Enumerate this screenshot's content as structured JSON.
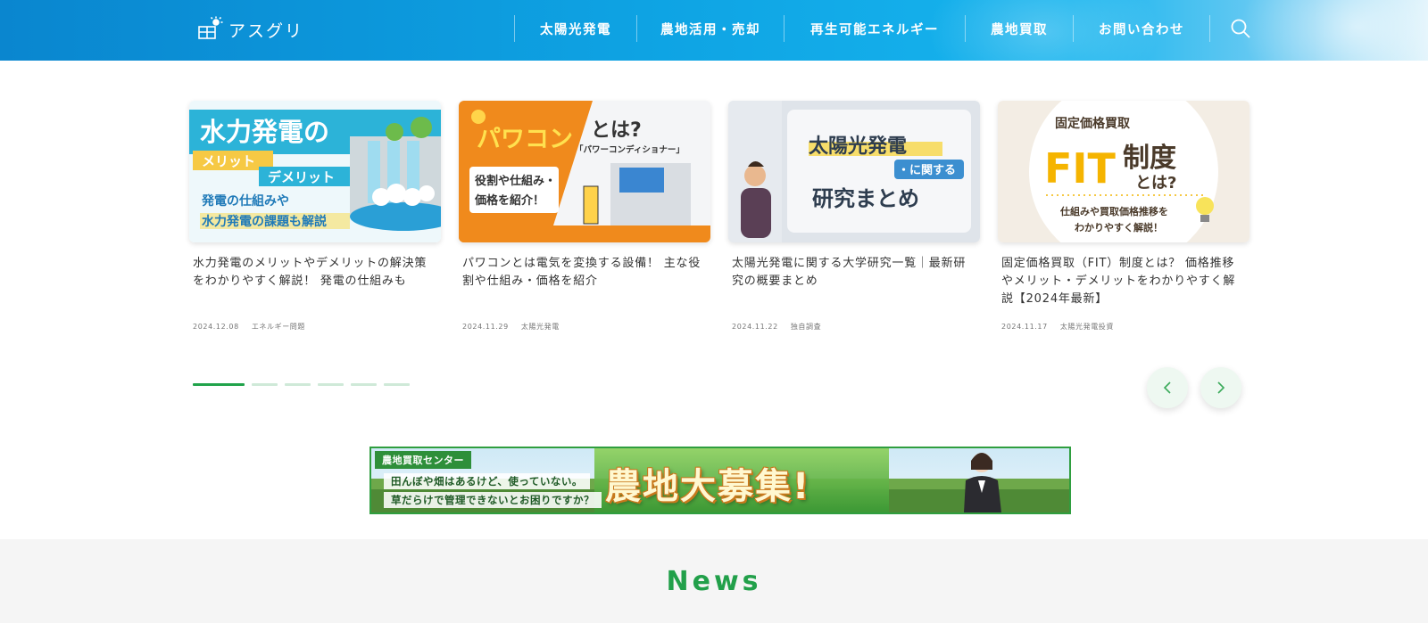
{
  "header": {
    "logo_text": "アスグリ",
    "nav": [
      {
        "label": "太陽光発電"
      },
      {
        "label": "農地活用・売却"
      },
      {
        "label": "再生可能エネルギー"
      },
      {
        "label": "農地買取"
      },
      {
        "label": "お問い合わせ"
      }
    ],
    "search_icon": "search-icon"
  },
  "carousel": {
    "cards": [
      {
        "title": "水力発電のメリットやデメリットの解決策をわかりやすく解説！ 発電の仕組みも",
        "date": "2024.12.08",
        "category": "エネルギー問題",
        "thumb": {
          "line1": "水力発電の",
          "badge1": "メリット",
          "badge2": "デメリット",
          "sub1": "発電の仕組みや",
          "sub2": "水力発電の課題も解説"
        }
      },
      {
        "title": "パワコンとは電気を変換する設備！ 主な役割や仕組み・価格を紹介",
        "date": "2024.11.29",
        "category": "太陽光発電",
        "thumb": {
          "line1": "パワコン",
          "line1b": "とは?",
          "sub0": "「パワーコンディショナー」",
          "sub1": "役割や仕組み・",
          "sub2": "価格を紹介！"
        }
      },
      {
        "title": "太陽光発電に関する大学研究一覧｜最新研究の概要まとめ",
        "date": "2024.11.22",
        "category": "独自調査",
        "thumb": {
          "line1": "太陽光発電",
          "badge": "・に関する",
          "line2": "研究まとめ"
        }
      },
      {
        "title": "固定価格買取（FIT）制度とは？ 価格推移やメリット・デメリットをわかりやすく解説【2024年最新】",
        "date": "2024.11.17",
        "category": "太陽光発電投資",
        "thumb": {
          "top": "固定価格買取",
          "fit": "FIT",
          "seido": "制度",
          "towa": "とは?",
          "sub1": "仕組みや買取価格推移を",
          "sub2": "わかりやすく解説！"
        }
      }
    ],
    "pagination_count": 6,
    "active_page": 1,
    "prev_icon": "chevron-left-icon",
    "next_icon": "chevron-right-icon"
  },
  "banner": {
    "tag": "農地買取センター",
    "line1": "田んぼや畑はあるけど、使っていない。",
    "line2": "草だらけで管理できないとお困りですか？",
    "main": "農地大募集!"
  },
  "news": {
    "title": "News"
  },
  "colors": {
    "header_blue": "#0a86cf",
    "accent_green": "#21a34b",
    "nav_text": "#ffffff"
  }
}
